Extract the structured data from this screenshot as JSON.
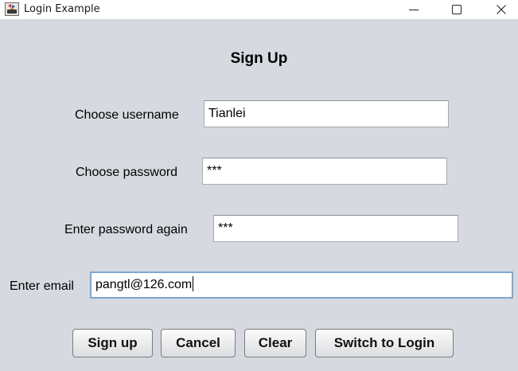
{
  "window": {
    "title": "Login Example",
    "icon": "java-app-icon",
    "controls": {
      "minimize": "minimize-icon",
      "maximize": "maximize-icon",
      "close": "close-icon"
    }
  },
  "form": {
    "heading": "Sign Up",
    "username": {
      "label": "Choose username",
      "value": "Tianlei"
    },
    "password": {
      "label": "Choose password",
      "value": "***"
    },
    "password_again": {
      "label": "Enter password again",
      "value": "***"
    },
    "email": {
      "label": "Enter email",
      "value": "pangtl@126.com"
    }
  },
  "buttons": {
    "sign_up": "Sign up",
    "cancel": "Cancel",
    "clear": "Clear",
    "switch_to_login": "Switch to Login"
  },
  "colors": {
    "background": "#d6d9df",
    "focus_border": "#7fa7cc"
  }
}
